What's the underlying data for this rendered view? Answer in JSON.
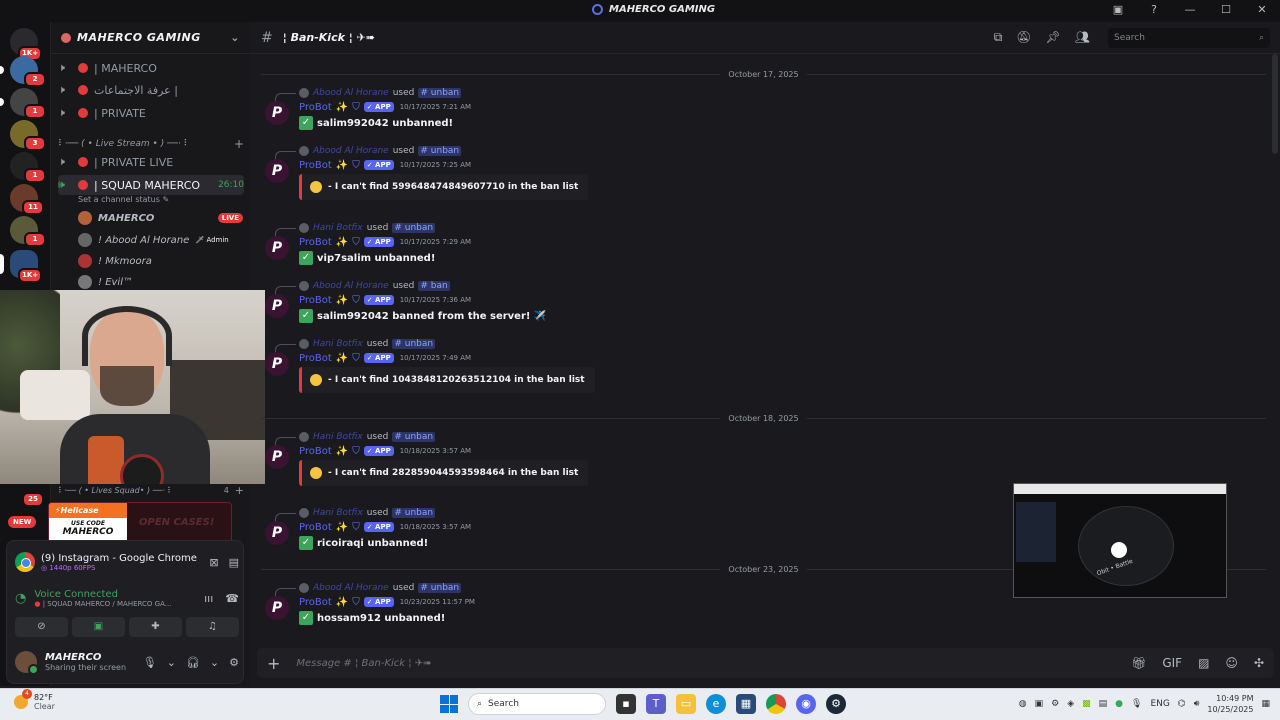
{
  "window": {
    "title": "MAHERCO GAMING"
  },
  "rail": {
    "servers": [
      {
        "badge": "1K+",
        "color": "#2a2a2e"
      },
      {
        "badge": "2",
        "color": "#3b6aa0"
      },
      {
        "badge": "1",
        "color": "#444"
      },
      {
        "badge": "3",
        "color": "#7a6a2a"
      },
      {
        "badge": "1",
        "color": "#222"
      },
      {
        "badge": "11",
        "color": "#6a3a2a"
      },
      {
        "badge": "1",
        "color": "#5a5a3a"
      },
      {
        "badge": "1K+",
        "color": "#2a4a7a"
      }
    ],
    "lower_badge": "25",
    "new_label": "NEW"
  },
  "sidebar": {
    "guild_name": "MAHERCO GAMING",
    "channels_top": [
      "| MAHERCO",
      "عرفة الاجتماعات |",
      "| PRIVATE"
    ],
    "category_live": "⠇·── ( • Live Stream • ) ──·⠸",
    "channels_mid": [
      "| PRIVATE LIVE",
      "| SQUAD MAHERCO"
    ],
    "squad_time": "26:10",
    "set_status": "Set a channel status",
    "voice_users": [
      {
        "name": "MAHERCO",
        "tag": "LIVE"
      },
      {
        "name": "! Abood Al Horane",
        "tag": "Admin"
      },
      {
        "name": "! Mkmoora",
        "tag": ""
      },
      {
        "name": "! Evil™",
        "tag": ""
      }
    ],
    "category_squad": "⠇·── ( • Lives Squad• ) ──·⠸",
    "squad_count": "4"
  },
  "promo": {
    "brand": "Hellcase",
    "use_code": "USE CODE",
    "code": "MAHERCO",
    "cta": "OPEN CASES!"
  },
  "stream": {
    "title": "(9) Instagram - Google Chrome",
    "quality": "1440p 60FPS"
  },
  "voice": {
    "status": "Voice Connected",
    "location": "| SQUAD MAHERCO / MAHERCO GA..."
  },
  "user": {
    "name": "MAHERCO",
    "status": "Sharing their screen"
  },
  "chat": {
    "channel_name": "¦ Ban-Kick ¦ ✈➠",
    "search_placeholder": "Search",
    "composer_placeholder": "Message # ¦ Ban-Kick ¦ ✈➠",
    "date_1": "October 17, 2025",
    "date_2": "October 18, 2025",
    "date_3": "October 23, 2025",
    "messages": [
      {
        "by": "Abood Al Horane",
        "cmd": "unban",
        "bot": "ProBot",
        "app": "APP",
        "time": "10/17/2025 7:21 AM",
        "kind": "ok",
        "text": "salim992042 unbanned!"
      },
      {
        "by": "Abood Al Horane",
        "cmd": "unban",
        "bot": "ProBot",
        "app": "APP",
        "time": "10/17/2025 7:25 AM",
        "kind": "err",
        "text": "- I can't find 599648474849607710 in the ban list"
      },
      {
        "by": "Hani Botfix",
        "cmd": "unban",
        "bot": "ProBot",
        "app": "APP",
        "time": "10/17/2025 7:29 AM",
        "kind": "ok",
        "text": "vip7salim unbanned!"
      },
      {
        "by": "Abood Al Horane",
        "cmd": "ban",
        "bot": "ProBot",
        "app": "APP",
        "time": "10/17/2025 7:36 AM",
        "kind": "ok",
        "text": "salim992042 banned from the server! ✈️"
      },
      {
        "by": "Hani Botfix",
        "cmd": "unban",
        "bot": "ProBot",
        "app": "APP",
        "time": "10/17/2025 7:49 AM",
        "kind": "err",
        "text": "- I can't find 1043848120263512104 in the ban list"
      },
      {
        "by": "Hani Botfix",
        "cmd": "unban",
        "bot": "ProBot",
        "app": "APP",
        "time": "10/18/2025 3:57 AM",
        "kind": "err",
        "text": "- I can't find 282859044593598464 in the ban list"
      },
      {
        "by": "Hani Botfix",
        "cmd": "unban",
        "bot": "ProBot",
        "app": "APP",
        "time": "10/18/2025 3:57 AM",
        "kind": "ok",
        "text": "ricoiraqi unbanned!"
      },
      {
        "by": "Abood Al Horane",
        "cmd": "unban",
        "bot": "ProBot",
        "app": "APP",
        "time": "10/23/2025 11:57 PM",
        "kind": "ok",
        "text": "hossam912 unbanned!"
      }
    ]
  },
  "pip": {
    "caption": "Obit • Battle"
  },
  "taskbar": {
    "weather_temp": "82°F",
    "weather_cond": "Clear",
    "weather_badge": "4",
    "search": "Search",
    "lang": "ENG",
    "time": "10:49 PM",
    "date": "10/25/2025"
  }
}
